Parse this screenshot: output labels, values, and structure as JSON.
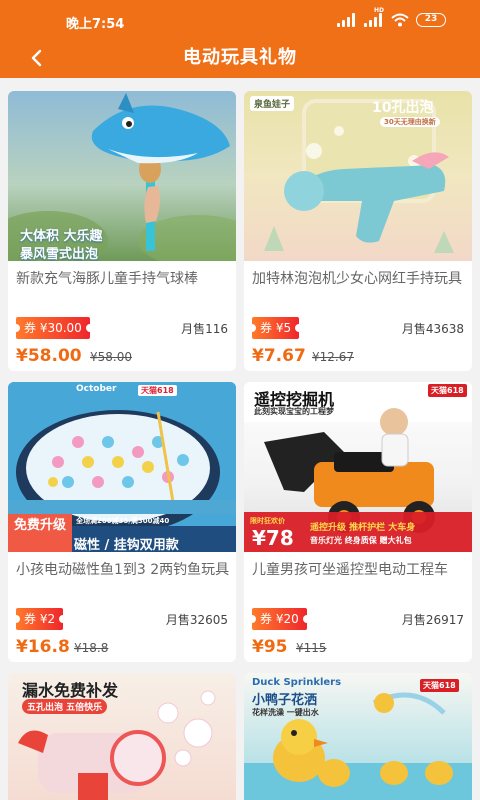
{
  "status_bar": {
    "time": "晚上7:54",
    "network": "HD",
    "battery": "23"
  },
  "header": {
    "title": "电动玩具礼物",
    "back_icon": "chevron-left-icon"
  },
  "colors": {
    "brand": "#f07018",
    "price": "#f06a12",
    "coupon_start": "#ff7a2b",
    "coupon_end": "#f0262c"
  },
  "products": [
    {
      "title": "新款充气海豚儿童手持气球棒",
      "coupon": "券 ¥30.00",
      "sales": "月售116",
      "price": "¥58.00",
      "original_price": "¥58.00",
      "image_text": [
        "大体积 大乐趣",
        "暴风雪式出泡"
      ]
    },
    {
      "title": "加特林泡泡机少女心网红手持玩具",
      "coupon": "券 ¥5",
      "sales": "月售43638",
      "price": "¥7.67",
      "original_price": "¥12.67",
      "image_text": [
        "泉鱼娃子",
        "10孔出泡",
        "30天无理由换新"
      ]
    },
    {
      "title": "小孩电动磁性鱼1到3 2两钓鱼玩具",
      "coupon": "券 ¥2",
      "sales": "月售32605",
      "price": "¥16.8",
      "original_price": "¥18.8",
      "image_text": [
        "October",
        "天猫618",
        "全场满200减35/满300减40",
        "免费升级",
        "磁性 / 挂钩双用款"
      ]
    },
    {
      "title": "儿童男孩可坐遥控型电动工程车",
      "coupon": "券 ¥20",
      "sales": "月售26917",
      "price": "¥95",
      "original_price": "¥115",
      "image_text": [
        "遥控挖掘机",
        "此刻实现宝宝的工程梦",
        "天猫618",
        "限时狂欢价",
        "¥78",
        "遥控升级 推杆护栏 大车身",
        "音乐灯光 终身质保 赠大礼包"
      ]
    },
    {
      "image_text": [
        "漏水免费补发",
        "五孔出泡 五倍快乐"
      ]
    },
    {
      "image_text": [
        "Duck Sprinklers",
        "小鸭子花洒",
        "天猫618",
        "花样洗澡 一键出水"
      ]
    }
  ]
}
